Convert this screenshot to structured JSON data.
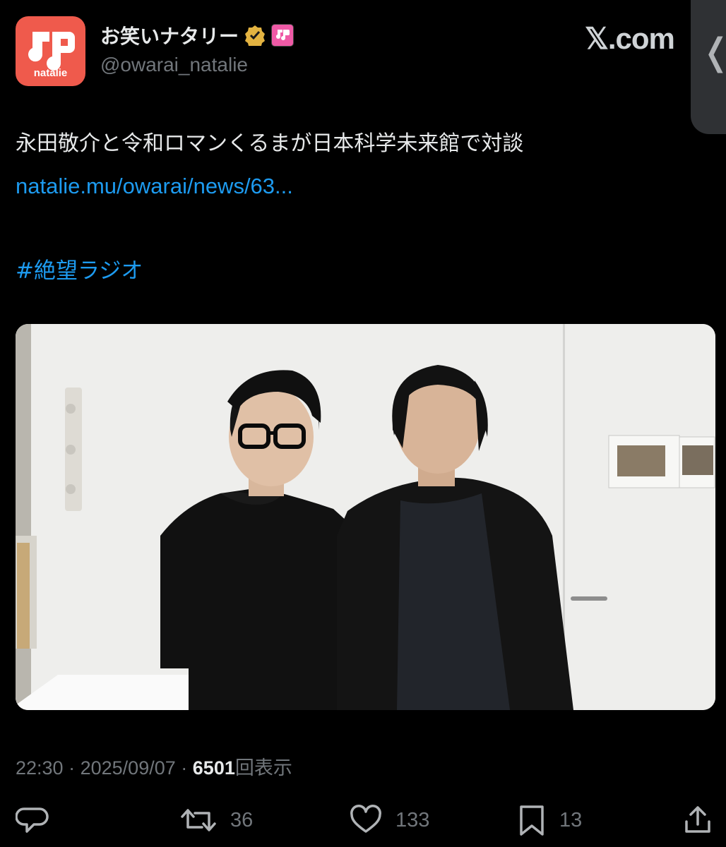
{
  "account": {
    "display_name": "お笑いナタリー",
    "handle": "@owarai_natalie",
    "avatar_text": "natalie",
    "verified_color": "#e3b341",
    "avatar_color": "#ef5a4c"
  },
  "header": {
    "site_label": "𝕏.com",
    "back_tab_icon": "chevron-left-icon"
  },
  "tweet": {
    "text": "永田敬介と令和ロマンくるまが日本科学未来館で対談",
    "link": "natalie.mu/owarai/news/63...",
    "hashtag": "#絶望ラジオ",
    "link_color": "#1d9bf0"
  },
  "meta": {
    "time": "22:30",
    "sep1": "·",
    "date": "2025/09/07",
    "sep2": "·",
    "views": "6501",
    "views_label": "回表示"
  },
  "actions": {
    "reply_count": "",
    "retweet_count": "36",
    "like_count": "133",
    "bookmark_count": "13"
  }
}
